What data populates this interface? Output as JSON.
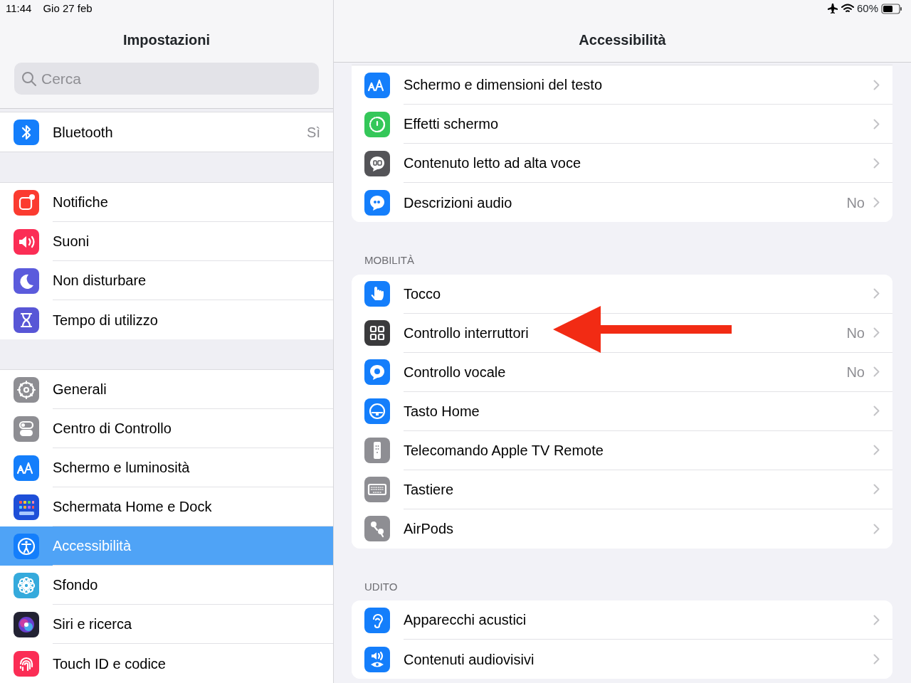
{
  "status_bar": {
    "time": "11:44",
    "date": "Gio 27 feb",
    "battery": "60%"
  },
  "sidebar": {
    "title": "Impostazioni",
    "search": {
      "placeholder": "Cerca"
    },
    "groups": [
      {
        "items": [
          {
            "label": "Bluetooth",
            "value": "Sì",
            "color": "#147efb",
            "selected": false
          }
        ]
      },
      {
        "items": [
          {
            "label": "Notifiche",
            "color": "#fb3b30",
            "selected": false
          },
          {
            "label": "Suoni",
            "color": "#fb2d55",
            "selected": false
          },
          {
            "label": "Non disturbare",
            "color": "#5b5bdc",
            "selected": false
          },
          {
            "label": "Tempo di utilizzo",
            "color": "#5856d6",
            "selected": false
          }
        ]
      },
      {
        "items": [
          {
            "label": "Generali",
            "color": "#8e8e93",
            "selected": false
          },
          {
            "label": "Centro di Controllo",
            "color": "#8e8e93",
            "selected": false
          },
          {
            "label": "Schermo e luminosità",
            "color": "#147efb",
            "selected": false
          },
          {
            "label": "Schermata Home e Dock",
            "color": "#1e4fd8",
            "selected": false
          },
          {
            "label": "Accessibilità",
            "color": "#147efb",
            "selected": true
          },
          {
            "label": "Sfondo",
            "color": "#35aadc",
            "selected": false
          },
          {
            "label": "Siri e ricerca",
            "color": "#222233",
            "selected": false
          },
          {
            "label": "Touch ID e codice",
            "color": "#fb2d55",
            "selected": false
          }
        ]
      }
    ]
  },
  "detail": {
    "title": "Accessibilità",
    "sections": [
      {
        "items": [
          {
            "label": "Schermo e dimensioni del testo",
            "color": "#147efb"
          },
          {
            "label": "Effetti schermo",
            "color": "#34c759"
          },
          {
            "label": "Contenuto letto ad alta voce",
            "color": "#545458"
          },
          {
            "label": "Descrizioni audio",
            "value": "No",
            "color": "#147efb"
          }
        ]
      },
      {
        "header": "MOBILITÀ",
        "items": [
          {
            "label": "Tocco",
            "color": "#147efb"
          },
          {
            "label": "Controllo interruttori",
            "value": "No",
            "color": "#3a3a3c"
          },
          {
            "label": "Controllo vocale",
            "value": "No",
            "color": "#147efb"
          },
          {
            "label": "Tasto Home",
            "color": "#147efb"
          },
          {
            "label": "Telecomando Apple TV Remote",
            "color": "#8e8e93"
          },
          {
            "label": "Tastiere",
            "color": "#8e8e93"
          },
          {
            "label": "AirPods",
            "color": "#8e8e93"
          }
        ]
      },
      {
        "header": "UDITO",
        "items": [
          {
            "label": "Apparecchi acustici",
            "color": "#147efb"
          },
          {
            "label": "Contenuti audiovisivi",
            "color": "#147efb"
          }
        ]
      }
    ]
  }
}
